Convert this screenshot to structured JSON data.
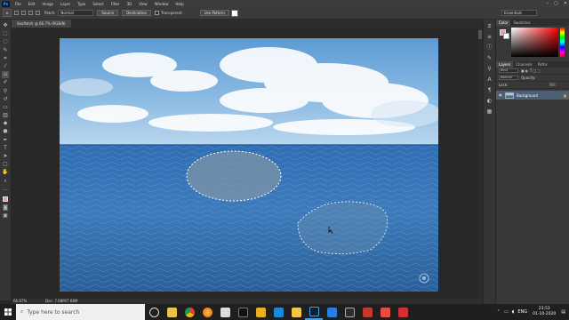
{
  "app": {
    "logo": "Ps",
    "menu": [
      "File",
      "Edit",
      "Image",
      "Layer",
      "Type",
      "Select",
      "Filter",
      "3D",
      "View",
      "Window",
      "Help"
    ],
    "window_controls": [
      "–",
      "▢",
      "✕"
    ]
  },
  "options_bar": {
    "mode_label": "Patch:",
    "mode_value": "Normal",
    "source_button": "Source",
    "destination_button": "Destination",
    "transparent_label": "Transparent",
    "use_pattern_button": "Use Pattern",
    "workspace": "Essentials"
  },
  "document": {
    "tab_label": "SeaPatch @ 66.7% (RGB/8)",
    "zoom": "66.67%",
    "doc_size": "Doc: 7.68M/7.68M"
  },
  "panels": {
    "color_tabs": [
      "Color",
      "Swatches"
    ],
    "layers_tabs": [
      "Layers",
      "Channels",
      "Paths"
    ],
    "kind_label": "Kind",
    "blend_mode": "Normal",
    "opacity_label": "Opacity:",
    "lock_label": "Lock:",
    "fill_label": "Fill:",
    "layer_name": "Background"
  },
  "colors": {
    "foreground": "#e8a0a0",
    "background": "#ffffff",
    "accent": "#31a8ff"
  },
  "taskbar": {
    "search_placeholder": "Type here to search",
    "apps": [
      "task-view-icon",
      "file-explorer-icon",
      "chrome-icon",
      "firefox-icon",
      "mail-icon",
      "notion-icon",
      "media-icon",
      "vscode-icon",
      "folder-icon",
      "photoshop-icon",
      "app-icon",
      "app2-icon",
      "app3-icon",
      "app4-icon",
      "pdf-icon"
    ],
    "lang": "ENG",
    "time": "23:53",
    "date": "01-10-2020"
  }
}
